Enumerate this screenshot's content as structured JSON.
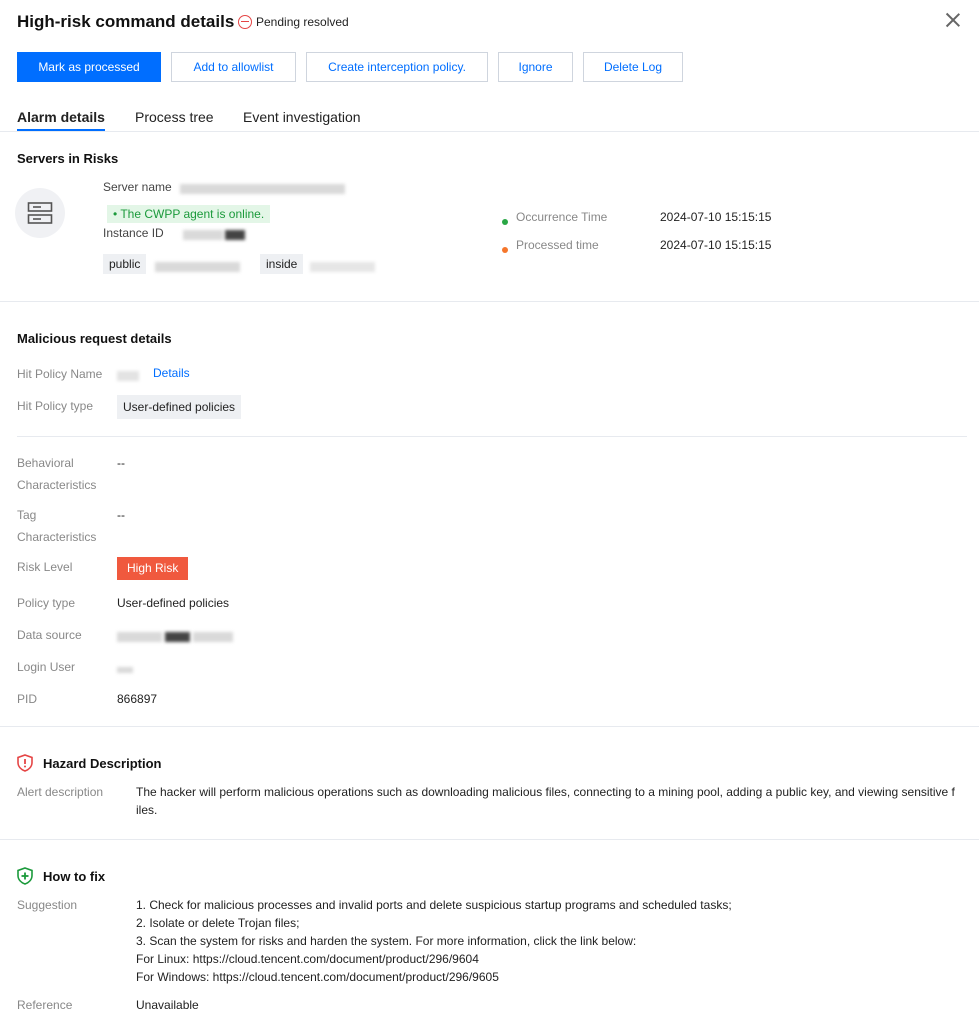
{
  "header": {
    "title": "High-risk command details",
    "status": "Pending resolved"
  },
  "toolbar": {
    "mark_processed": "Mark as processed",
    "add_allowlist": "Add to allowlist",
    "create_policy": "Create interception policy.",
    "ignore": "Ignore",
    "delete_log": "Delete Log"
  },
  "tabs": [
    {
      "label": "Alarm details"
    },
    {
      "label": "Process tree"
    },
    {
      "label": "Event investigation"
    }
  ],
  "servers": {
    "title": "Servers in Risks",
    "server_name_label": "Server name",
    "agent_status": "• The CWPP agent is online.",
    "instance_id_label": "Instance ID",
    "public_label": "public",
    "inside_label": "inside",
    "occurrence_label": "Occurrence Time",
    "occurrence_value": "2024-07-10 15:15:15",
    "processed_label": "Processed time",
    "processed_value": "2024-07-10 15:15:15"
  },
  "malicious": {
    "title": "Malicious request details",
    "hit_policy_name_label": "Hit Policy Name",
    "details_link": "Details",
    "hit_policy_type_label": "Hit Policy type",
    "hit_policy_type_value": "User-defined policies",
    "behavioral_label_1": "Behavioral",
    "behavioral_label_2": "Characteristics",
    "behavioral_value": "--",
    "tag_label_1": "Tag",
    "tag_label_2": "Characteristics",
    "tag_value": "--",
    "risk_level_label": "Risk Level",
    "risk_level_value": "High Risk",
    "policy_type_label": "Policy type",
    "policy_type_value": "User-defined policies",
    "data_source_label": "Data source",
    "login_user_label": "Login User",
    "pid_label": "PID",
    "pid_value": "866897"
  },
  "hazard": {
    "title": "Hazard Description",
    "alert_label": "Alert description",
    "alert_line1": "The hacker will perform malicious operations such as downloading malicious files, connecting to a mining pool, adding a public key, and viewing sensitive f",
    "alert_line2": "iles."
  },
  "fix": {
    "title": "How to fix",
    "suggestion_label": "Suggestion",
    "suggestion_lines": [
      "1. Check for malicious processes and invalid ports and delete suspicious startup programs and scheduled tasks;",
      "2. Isolate or delete Trojan files;",
      "3. Scan the system for risks and harden the system. For more information, click the link below:",
      "For Linux: https://cloud.tencent.com/document/product/296/9604",
      "For Windows: https://cloud.tencent.com/document/product/296/9605"
    ],
    "reference_label": "Reference",
    "reference_value": "Unavailable"
  },
  "colors": {
    "primary": "#006eff",
    "danger": "#f0593e",
    "online_green": "#1b9a3b",
    "pending_red": "#e54545"
  }
}
